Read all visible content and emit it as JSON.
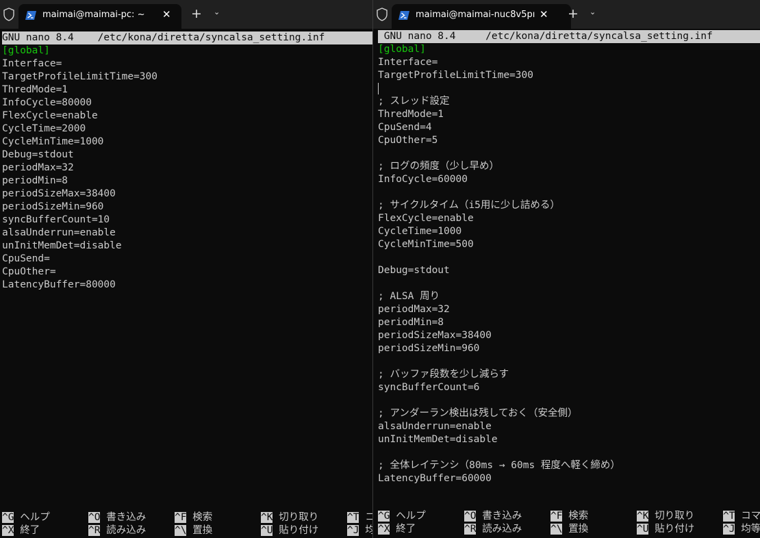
{
  "left_window": {
    "tab_title": "maimai@maimai-pc: ~",
    "tab_close": "✕",
    "new_tab": "+",
    "dropdown": "⌄",
    "nano_title": "GNU nano 8.4    /etc/kona/diretta/syncalsa_setting.inf",
    "lines": [
      "[global]",
      "Interface=",
      "TargetProfileLimitTime=300",
      "ThredMode=1",
      "InfoCycle=80000",
      "FlexCycle=enable",
      "CycleTime=2000",
      "CycleMinTime=1000",
      "Debug=stdout",
      "periodMax=32",
      "periodMin=8",
      "periodSizeMax=38400",
      "periodSizeMin=960",
      "syncBufferCount=10",
      "alsaUnderrun=enable",
      "unInitMemDet=disable",
      "CpuSend=",
      "CpuOther=",
      "LatencyBuffer=80000"
    ],
    "shortcuts_row1": [
      {
        "key": "^G",
        "desc": " ヘルプ"
      },
      {
        "key": "^O",
        "desc": " 書き込み"
      },
      {
        "key": "^F",
        "desc": " 検索"
      },
      {
        "key": "^K",
        "desc": " 切り取り"
      },
      {
        "key": "^T",
        "desc": " コ"
      }
    ],
    "shortcuts_row2": [
      {
        "key": "^X",
        "desc": " 終了"
      },
      {
        "key": "^R",
        "desc": " 読み込み"
      },
      {
        "key": "^\\",
        "desc": " 置換"
      },
      {
        "key": "^U",
        "desc": " 貼り付け"
      },
      {
        "key": "^J",
        "desc": " 均"
      }
    ]
  },
  "right_window": {
    "tab_title": "maimai@maimai-nuc8v5pı",
    "tab_close": "✕",
    "new_tab": "+",
    "dropdown": "⌄",
    "nano_title": " GNU nano 8.4     /etc/kona/diretta/syncalsa_setting.inf",
    "lines": [
      "[global]",
      "Interface=",
      "TargetProfileLimitTime=300",
      "",
      "; スレッド設定",
      "ThredMode=1",
      "CpuSend=4",
      "CpuOther=5",
      "",
      "; ログの頻度（少し早め）",
      "InfoCycle=60000",
      "",
      "; サイクルタイム（i5用に少し詰める）",
      "FlexCycle=enable",
      "CycleTime=1000",
      "CycleMinTime=500",
      "",
      "Debug=stdout",
      "",
      "; ALSA 周り",
      "periodMax=32",
      "periodMin=8",
      "periodSizeMax=38400",
      "periodSizeMin=960",
      "",
      "; バッファ段数を少し減らす",
      "syncBufferCount=6",
      "",
      "; アンダーラン検出は残しておく（安全側）",
      "alsaUnderrun=enable",
      "unInitMemDet=disable",
      "",
      "; 全体レイテンシ（80ms → 60ms 程度へ軽く締め）",
      "LatencyBuffer=60000"
    ],
    "shortcuts_row1": [
      {
        "key": "^G",
        "desc": " ヘルプ"
      },
      {
        "key": "^O",
        "desc": " 書き込み"
      },
      {
        "key": "^F",
        "desc": " 検索"
      },
      {
        "key": "^K",
        "desc": " 切り取り"
      },
      {
        "key": "^T",
        "desc": " コマ"
      }
    ],
    "shortcuts_row2": [
      {
        "key": "^X",
        "desc": " 終了"
      },
      {
        "key": "^R",
        "desc": " 読み込み"
      },
      {
        "key": "^\\",
        "desc": " 置換"
      },
      {
        "key": "^U",
        "desc": " 貼り付け"
      },
      {
        "key": "^J",
        "desc": " 均等"
      }
    ]
  },
  "colors": {
    "background": "#0c0c0c",
    "text": "#cccccc",
    "section_header": "#16c60c",
    "tabbar": "#202020",
    "powershell_icon": "#2b6fd1"
  }
}
